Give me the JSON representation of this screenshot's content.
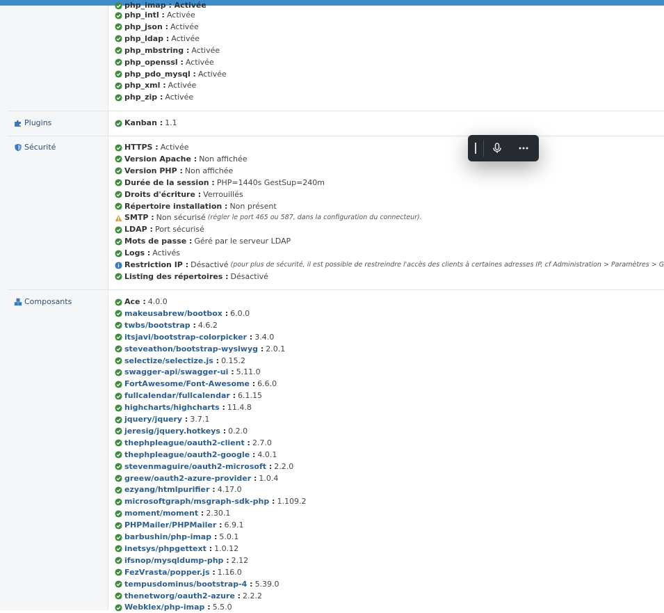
{
  "colors": {
    "ok": "#3f8a3f",
    "warn": "#e6a020",
    "info": "#3a78c0",
    "link": "#2f5f8f",
    "topbar": "#3c8dca"
  },
  "modules_top_partial": "php_imap : Activée",
  "modules": [
    {
      "k": "php_intl",
      "v": "Activée"
    },
    {
      "k": "php_json",
      "v": "Activée"
    },
    {
      "k": "php_ldap",
      "v": "Activée"
    },
    {
      "k": "php_mbstring",
      "v": "Activée"
    },
    {
      "k": "php_openssl",
      "v": "Activée"
    },
    {
      "k": "php_pdo_mysql",
      "v": "Activée"
    },
    {
      "k": "php_xml",
      "v": "Activée"
    },
    {
      "k": "php_zip",
      "v": "Activée"
    }
  ],
  "sections": {
    "plugins": {
      "label": "Plugins",
      "icon": "puzzle-icon"
    },
    "securite": {
      "label": "Sécurité",
      "icon": "shield-icon"
    },
    "composants": {
      "label": "Composants",
      "icon": "cubes-icon"
    }
  },
  "plugins": [
    {
      "k": "Kanban",
      "v": "1.1"
    }
  ],
  "securite": [
    {
      "k": "HTTPS",
      "v": "Activée",
      "s": "ok"
    },
    {
      "k": "Version Apache",
      "v": "Non affichée",
      "s": "ok"
    },
    {
      "k": "Version PHP",
      "v": "Non affichée",
      "s": "ok"
    },
    {
      "k": "Durée de la session",
      "v": "PHP=1440s GestSup=240m",
      "s": "ok"
    },
    {
      "k": "Droits d'écriture",
      "v": "Verrouillés",
      "s": "ok"
    },
    {
      "k": "Répertoire installation",
      "v": "Non présent",
      "s": "ok"
    },
    {
      "k": "SMTP",
      "v": "Non sécurisé",
      "n": "(régler le port 465 ou 587, dans la configuration du connecteur).",
      "s": "warn"
    },
    {
      "k": "LDAP",
      "v": "Port sécurisé",
      "s": "ok"
    },
    {
      "k": "Mots de passe",
      "v": "Géré par le serveur LDAP",
      "s": "ok"
    },
    {
      "k": "Logs",
      "v": "Activés",
      "s": "ok"
    },
    {
      "k": "Restriction IP",
      "v": "Désactivé",
      "n": "(pour plus de sécurité, il est possible de restreindre l'accès des clients à certaines adresses IP, cf Administration > Paramètres > Géné",
      "s": "info"
    },
    {
      "k": "Listing des répertoires",
      "v": "Désactivé",
      "s": "ok"
    }
  ],
  "composants": [
    {
      "k": "Ace",
      "v": "4.0.0",
      "link": false
    },
    {
      "k": "makeusabrew/bootbox",
      "v": "6.0.0",
      "link": true
    },
    {
      "k": "twbs/bootstrap",
      "v": "4.6.2",
      "link": true
    },
    {
      "k": "itsjavi/bootstrap-colorpicker",
      "v": "3.4.0",
      "link": true
    },
    {
      "k": "steveathon/bootstrap-wysiwyg",
      "v": "2.0.1",
      "link": true
    },
    {
      "k": "selectize/selectize.js",
      "v": "0.15.2",
      "link": true
    },
    {
      "k": "swagger-api/swagger-ui",
      "v": "5.11.0",
      "link": true
    },
    {
      "k": "FortAwesome/Font-Awesome",
      "v": "6.6.0",
      "link": true
    },
    {
      "k": "fullcalendar/fullcalendar",
      "v": "6.1.15",
      "link": true
    },
    {
      "k": "highcharts/highcharts",
      "v": "11.4.8",
      "link": true
    },
    {
      "k": "jquery/jquery",
      "v": "3.7.1",
      "link": true
    },
    {
      "k": "jeresig/jquery.hotkeys",
      "v": "0.2.0",
      "link": true
    },
    {
      "k": "thephpleague/oauth2-client",
      "v": "2.7.0",
      "link": true
    },
    {
      "k": "thephpleague/oauth2-google",
      "v": "4.0.1",
      "link": true
    },
    {
      "k": "stevenmaguire/oauth2-microsoft",
      "v": "2.2.0",
      "link": true
    },
    {
      "k": "greew/oauth2-azure-provider",
      "v": "1.0.4",
      "link": true
    },
    {
      "k": "ezyang/htmlpurifier",
      "v": "4.17.0",
      "link": true
    },
    {
      "k": "microsoftgraph/msgraph-sdk-php",
      "v": "1.109.2",
      "link": true
    },
    {
      "k": "moment/moment",
      "v": "2.30.1",
      "link": true
    },
    {
      "k": "PHPMailer/PHPMailer",
      "v": "6.9.1",
      "link": true
    },
    {
      "k": "barbushin/php-imap",
      "v": "5.0.1",
      "link": true
    },
    {
      "k": "inetsys/phpgettext",
      "v": "1.0.12",
      "link": true
    },
    {
      "k": "ifsnop/mysqldump-php",
      "v": "2.12",
      "link": true
    },
    {
      "k": "FezVrasta/popper.js",
      "v": "1.16.0",
      "link": true
    },
    {
      "k": "tempusdominus/bootstrap-4",
      "v": "5.39.0",
      "link": true
    },
    {
      "k": "thenetworg/oauth2-azure",
      "v": "2.2.2",
      "link": true
    },
    {
      "k": "Webklex/php-imap",
      "v": "5.5.0",
      "link": true
    }
  ],
  "toolbar": {
    "icons": [
      "text-cursor-icon",
      "microphone-icon",
      "more-icon"
    ]
  }
}
